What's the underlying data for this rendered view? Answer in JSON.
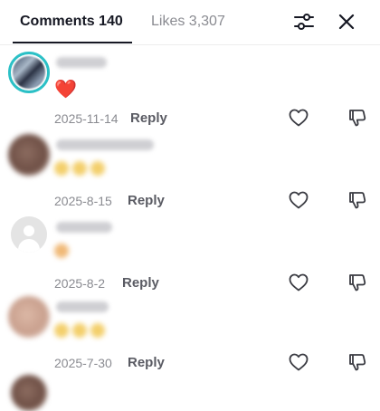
{
  "tabs": [
    {
      "label": "Comments 140",
      "active": true
    },
    {
      "label": "Likes 3,307",
      "active": false
    }
  ],
  "header_icons": {
    "filter": "sliders-icon",
    "close": "close-icon"
  },
  "comments": [
    {
      "text": "❤️",
      "date": "2025-11-14",
      "reply_label": "Reply"
    },
    {
      "text": "",
      "date": "2025-8-15",
      "reply_label": "Reply"
    },
    {
      "text": "",
      "date": "2025-8-2",
      "reply_label": "Reply"
    },
    {
      "text": "",
      "date": "2025-7-30",
      "reply_label": "Reply"
    }
  ],
  "colors": {
    "accent_ring": "#2bc0c6",
    "text_primary": "#161823",
    "text_secondary": "#8a8b91"
  }
}
